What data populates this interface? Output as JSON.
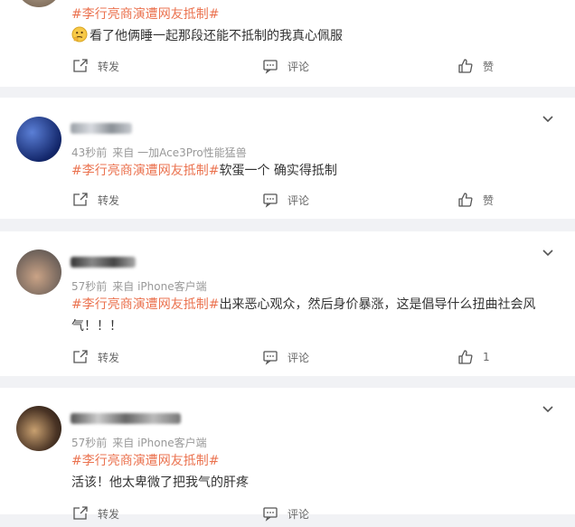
{
  "posts": [
    {
      "topic": "#李行亮商演遭网友抵制#",
      "text": "看了他俩睡一起那段还能不抵制的我真心佩服",
      "actions": {
        "repost": "转发",
        "comment": "评论",
        "like": "赞"
      }
    },
    {
      "time": "43秒前",
      "source": "来自 一加Ace3Pro性能猛兽",
      "topic": "#李行亮商演遭网友抵制#",
      "text": "软蛋一个 确实得抵制",
      "actions": {
        "repost": "转发",
        "comment": "评论",
        "like": "赞"
      }
    },
    {
      "time": "57秒前",
      "source": "来自 iPhone客户端",
      "topic": "#李行亮商演遭网友抵制#",
      "text": "出来恶心观众，然后身价暴涨，这是倡导什么扭曲社会风气！！！",
      "actions": {
        "repost": "转发",
        "comment": "评论",
        "like": "1"
      }
    },
    {
      "time": "57秒前",
      "source": "来自 iPhone客户端",
      "topic": "#李行亮商演遭网友抵制#",
      "text": "活该！他太卑微了把我气的肝疼",
      "actions": {
        "repost": "转发",
        "comment": "评论"
      }
    }
  ],
  "icons": {
    "repost": "repost-icon",
    "comment": "comment-icon",
    "like": "thumbs-up-icon",
    "more": "chevron-down-icon",
    "emoji": "thinking-face-emoji"
  },
  "colors": {
    "topic": "#eb7350",
    "meta": "#999999",
    "background": "#f1f2f5"
  }
}
